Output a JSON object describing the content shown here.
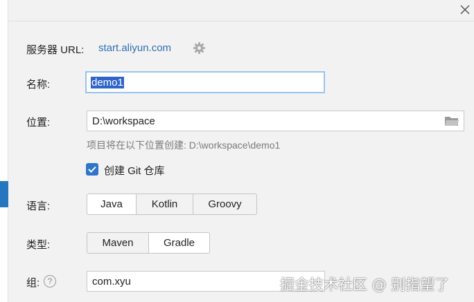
{
  "server": {
    "label": "服务器 URL:",
    "url": "start.aliyun.com",
    "icon": "gear-icon"
  },
  "name": {
    "label": "名称:",
    "value": "demo1"
  },
  "location": {
    "label": "位置:",
    "value": "D:\\workspace",
    "hint": "项目将在以下位置创建: D:\\workspace\\demo1",
    "icon": "folder-icon"
  },
  "git": {
    "label": "创建 Git 仓库",
    "checked": true
  },
  "language": {
    "label": "语言:",
    "options": [
      "Java",
      "Kotlin",
      "Groovy"
    ],
    "selected": "Java"
  },
  "type": {
    "label": "类型:",
    "options": [
      "Maven",
      "Gradle"
    ],
    "selected": "Gradle"
  },
  "group": {
    "label": "组:",
    "value": "com.xyu",
    "help": "?"
  },
  "watermark": "掘金技术社区 @ 别指望了",
  "colors": {
    "accent": "#2f75c9",
    "link": "#2d6fb3",
    "selection": "#2f65ca",
    "focus_border": "#97c3f0"
  }
}
